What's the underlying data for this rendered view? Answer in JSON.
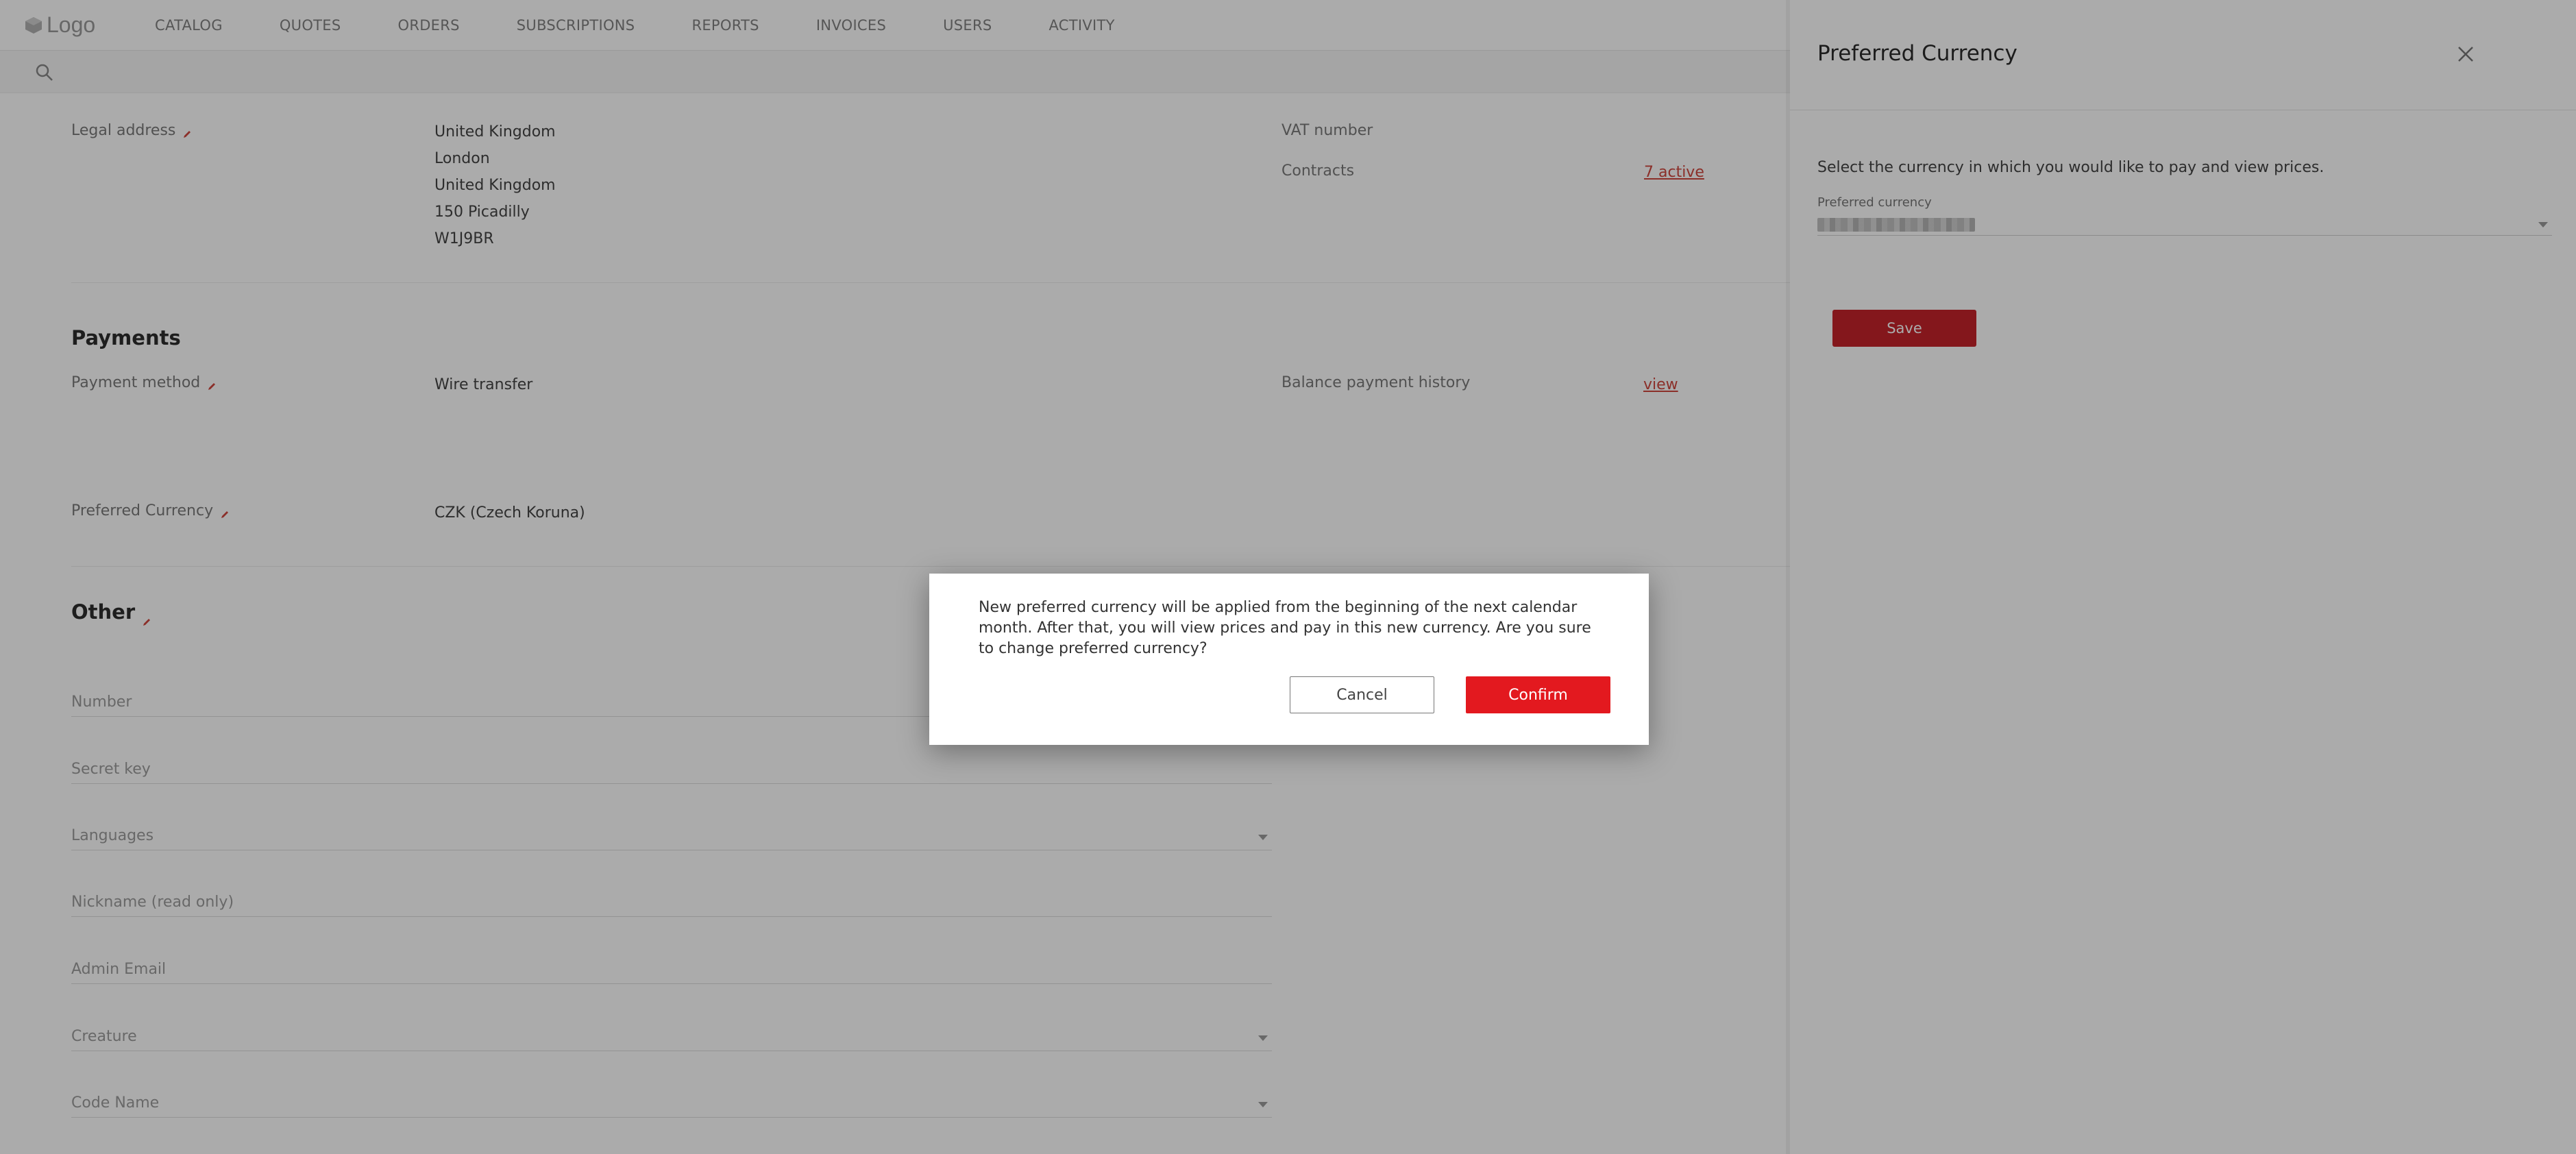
{
  "header": {
    "logo_text": "Logo",
    "nav": [
      "CATALOG",
      "QUOTES",
      "ORDERS",
      "SUBSCRIPTIONS",
      "REPORTS",
      "INVOICES",
      "USERS",
      "ACTIVITY"
    ]
  },
  "account": {
    "legal_address_label": "Legal address",
    "legal_address_lines": [
      "United Kingdom",
      "London",
      "United Kingdom",
      "150 Picadilly",
      "W1J9BR"
    ],
    "vat_number_label": "VAT number",
    "contracts_label": "Contracts",
    "contracts_value": "7 active"
  },
  "payments": {
    "section_title": "Payments",
    "payment_method_label": "Payment method",
    "payment_method_value": "Wire transfer",
    "balance_history_label": "Balance payment history",
    "balance_history_link": "view",
    "preferred_currency_label": "Preferred Currency",
    "preferred_currency_value": "CZK (Czech Koruna)"
  },
  "other": {
    "section_title": "Other",
    "fields": [
      "Number",
      "Secret key",
      "Languages",
      "Nickname (read only)",
      "Admin Email",
      "Creature",
      "Code Name"
    ]
  },
  "panel": {
    "title": "Preferred Currency",
    "description": "Select the currency in which you would like to pay and view prices.",
    "field_label": "Preferred currency",
    "save_label": "Save"
  },
  "modal": {
    "message": "New preferred currency will be applied from the beginning of the next calendar month. After that, you will view prices and pay in this new currency. Are you sure to change preferred currency?",
    "cancel_label": "Cancel",
    "confirm_label": "Confirm"
  },
  "colors": {
    "accent_red": "#e3191f",
    "save_red": "#c5232a",
    "link_red": "#d0473e"
  }
}
